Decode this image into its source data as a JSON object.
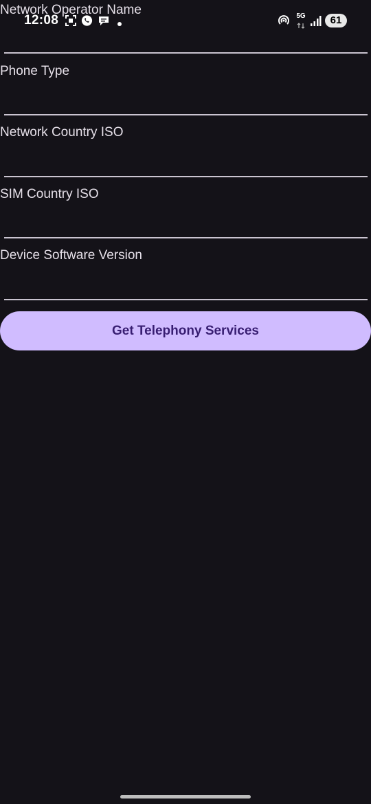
{
  "status_bar": {
    "time": "12:08",
    "battery_level": "61",
    "network_type": "5G",
    "icons": [
      "screenshot-icon",
      "whatsapp-icon",
      "chat-icon",
      "dot-icon",
      "hotspot-icon",
      "5g-icon",
      "signal-icon",
      "battery-icon"
    ]
  },
  "form": {
    "fields": [
      {
        "label": "Network Operator Name",
        "value": ""
      },
      {
        "label": "Phone Type",
        "value": ""
      },
      {
        "label": "Network Country ISO",
        "value": ""
      },
      {
        "label": "SIM Country ISO",
        "value": ""
      },
      {
        "label": "Device Software Version",
        "value": ""
      }
    ],
    "submit_label": "Get Telephony Services"
  },
  "colors": {
    "background": "#141218",
    "button": "#d0bcff",
    "button_text": "#381e72",
    "underline": "#cac4d0"
  }
}
